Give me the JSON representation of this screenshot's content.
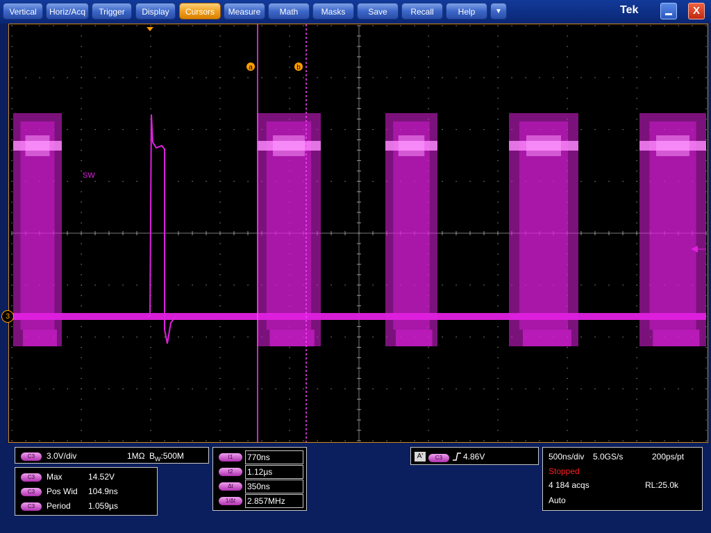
{
  "menu": {
    "items": [
      "Vertical",
      "Horiz/Acq",
      "Trigger",
      "Display",
      "Cursors",
      "Measure",
      "Math",
      "Masks",
      "Save",
      "Recall",
      "Help"
    ],
    "active": "Cursors",
    "overflow_icon": "triangle-down-icon",
    "brand": "Tek",
    "minimize_icon": "minimize-icon",
    "close_label": "X"
  },
  "screen": {
    "cursor_a_label": "a",
    "cursor_b_label": "b",
    "channel_marker": "3",
    "waveform_label": "SW",
    "trigger_position_icon": "trigger-position-icon",
    "trigger_level_icon": "trigger-level-arrow-icon",
    "waveform_color": "#e020e0",
    "cursor_color": "#ff40ff",
    "marker_color": "#ff9d00"
  },
  "channel": {
    "badge": "C3",
    "scale": "3.0V/div",
    "coupling": "1MΩ",
    "bw_prefix": "B",
    "bw_sub": "W",
    "bw_value": ":500M"
  },
  "measurements": [
    {
      "badge": "C3",
      "name": "Max",
      "value": "14.52V"
    },
    {
      "badge": "C3",
      "name": "Pos Wid",
      "value": "104.9ns"
    },
    {
      "badge": "C3",
      "name": "Period",
      "value": "1.059µs"
    }
  ],
  "cursors": [
    {
      "label": "t1",
      "value": "770ns"
    },
    {
      "label": "t2",
      "value": "1.12µs"
    },
    {
      "label": "Δt",
      "value": "350ns"
    },
    {
      "label": "1/Δt",
      "value": "2.857MHz"
    }
  ],
  "trigger": {
    "mode_badge": "A'",
    "source_badge": "C3",
    "slope_icon": "rising-edge-icon",
    "level": "4.86V"
  },
  "acquisition": {
    "timebase": "500ns/div",
    "sample_rate": "5.0GS/s",
    "resolution": "200ps/pt",
    "status": "Stopped",
    "acqs": "4 184 acqs",
    "record_length": "RL:25.0k",
    "trigger_mode": "Auto"
  }
}
